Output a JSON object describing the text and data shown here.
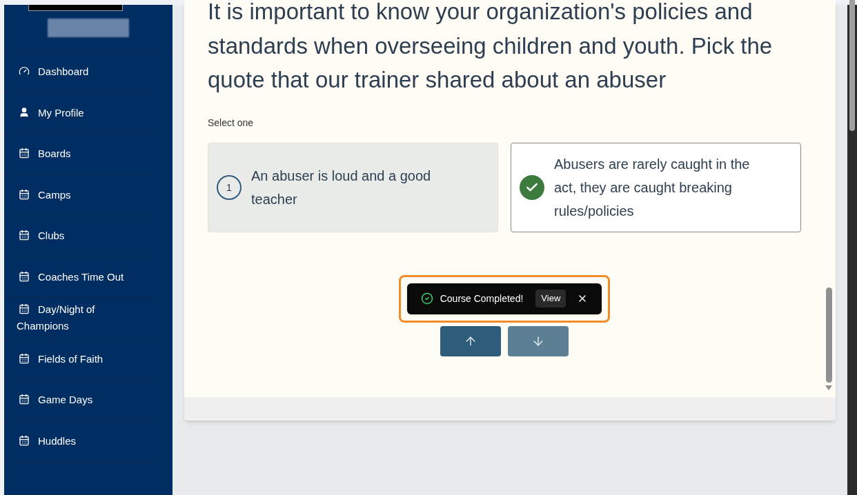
{
  "sidebar": {
    "items": [
      {
        "label": "Dashboard",
        "kind": "dashboard"
      },
      {
        "label": "My Profile",
        "kind": "profile"
      },
      {
        "label": "Boards",
        "kind": "calendar"
      },
      {
        "label": "Camps",
        "kind": "calendar"
      },
      {
        "label": "Clubs",
        "kind": "calendar"
      },
      {
        "label": "Coaches Time Out",
        "kind": "calendar"
      },
      {
        "label": "Day/Night of Champions",
        "kind": "calendar"
      },
      {
        "label": "Fields of Faith",
        "kind": "calendar"
      },
      {
        "label": "Game Days",
        "kind": "calendar"
      },
      {
        "label": "Huddles",
        "kind": "calendar"
      }
    ]
  },
  "question": {
    "text": "It is important to know your organization's policies and standards when overseeing children and youth. Pick the quote that our trainer shared about an abuser",
    "instruction": "Select one",
    "options": [
      {
        "number": "1",
        "text": "An abuser is loud and a good teacher",
        "selected": false
      },
      {
        "text": "Abusers are rarely caught in the act, they are caught breaking rules/policies",
        "selected": true
      }
    ]
  },
  "toast": {
    "message": "Course Completed!",
    "action": "View",
    "highlighted": true
  },
  "navigation": {
    "up_disabled": false,
    "down_disabled": true
  }
}
